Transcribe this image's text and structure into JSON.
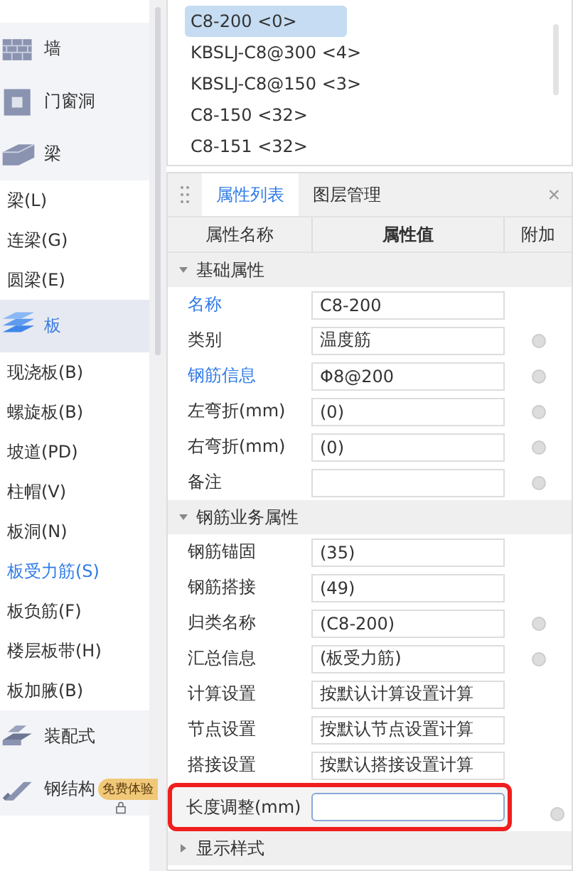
{
  "sidebar": {
    "items": [
      {
        "kind": "category",
        "label": "墙",
        "selected": false
      },
      {
        "kind": "category",
        "label": "门窗洞",
        "selected": false
      },
      {
        "kind": "category",
        "label": "梁",
        "selected": false
      },
      {
        "kind": "item",
        "label": "梁(L)",
        "selected": false
      },
      {
        "kind": "item",
        "label": "连梁(G)",
        "selected": false
      },
      {
        "kind": "item",
        "label": "圆梁(E)",
        "selected": false
      },
      {
        "kind": "category",
        "label": "板",
        "selected": true
      },
      {
        "kind": "item",
        "label": "现浇板(B)",
        "selected": false
      },
      {
        "kind": "item",
        "label": "螺旋板(B)",
        "selected": false
      },
      {
        "kind": "item",
        "label": "坡道(PD)",
        "selected": false
      },
      {
        "kind": "item",
        "label": "柱帽(V)",
        "selected": false
      },
      {
        "kind": "item",
        "label": "板洞(N)",
        "selected": false
      },
      {
        "kind": "item",
        "label": "板受力筋(S)",
        "selected": true
      },
      {
        "kind": "item",
        "label": "板负筋(F)",
        "selected": false
      },
      {
        "kind": "item",
        "label": "楼层板带(H)",
        "selected": false
      },
      {
        "kind": "item",
        "label": "板加腋(B)",
        "selected": false
      },
      {
        "kind": "category",
        "label": "装配式",
        "selected": false
      },
      {
        "kind": "category",
        "label": "钢结构",
        "selected": false,
        "badge": "免费体验",
        "locked": true
      }
    ]
  },
  "components": [
    {
      "label": "C8-200 <0>",
      "selected": true
    },
    {
      "label": "KBSLJ-C8@300 <4>",
      "selected": false
    },
    {
      "label": "KBSLJ-C8@150 <3>",
      "selected": false
    },
    {
      "label": "C8-150 <32>",
      "selected": false
    },
    {
      "label": "C8-151 <32>",
      "selected": false
    }
  ],
  "tabs": [
    {
      "label": "属性列表",
      "selected": true
    },
    {
      "label": "图层管理",
      "selected": false
    }
  ],
  "close": "×",
  "table": {
    "columns": [
      "属性名称",
      "属性值",
      "附加"
    ],
    "groups": [
      {
        "label": "基础属性",
        "expanded": true,
        "rows": [
          {
            "name": "名称",
            "value": "C8-200",
            "link": true,
            "extra": false
          },
          {
            "name": "类别",
            "value": "温度筋",
            "link": false,
            "extra": true
          },
          {
            "name": "钢筋信息",
            "value": "Φ8@200",
            "link": true,
            "extra": true
          },
          {
            "name": "左弯折(mm)",
            "value": "(0)",
            "link": false,
            "extra": true
          },
          {
            "name": "右弯折(mm)",
            "value": "(0)",
            "link": false,
            "extra": true
          },
          {
            "name": "备注",
            "link": false,
            "extra": true
          }
        ]
      },
      {
        "label": "钢筋业务属性",
        "expanded": true,
        "rows": [
          {
            "name": "钢筋锚固",
            "value": "(35)",
            "link": false,
            "extra": false
          },
          {
            "name": "钢筋搭接",
            "value": "(49)",
            "link": false,
            "extra": false
          },
          {
            "name": "归类名称",
            "value": "(C8-200)",
            "link": false,
            "extra": true
          },
          {
            "name": "汇总信息",
            "value": "(板受力筋)",
            "link": false,
            "extra": true
          },
          {
            "name": "计算设置",
            "value": "按默认计算设置计算",
            "link": false,
            "extra": false
          },
          {
            "name": "节点设置",
            "value": "按默认节点设置计算",
            "link": false,
            "extra": false
          },
          {
            "name": "搭接设置",
            "value": "按默认搭接设置计算",
            "link": false,
            "extra": false
          },
          {
            "name": "长度调整(mm)",
            "link": false,
            "extra": true,
            "highlighted": true
          }
        ]
      },
      {
        "label": "显示样式",
        "expanded": false
      }
    ]
  }
}
